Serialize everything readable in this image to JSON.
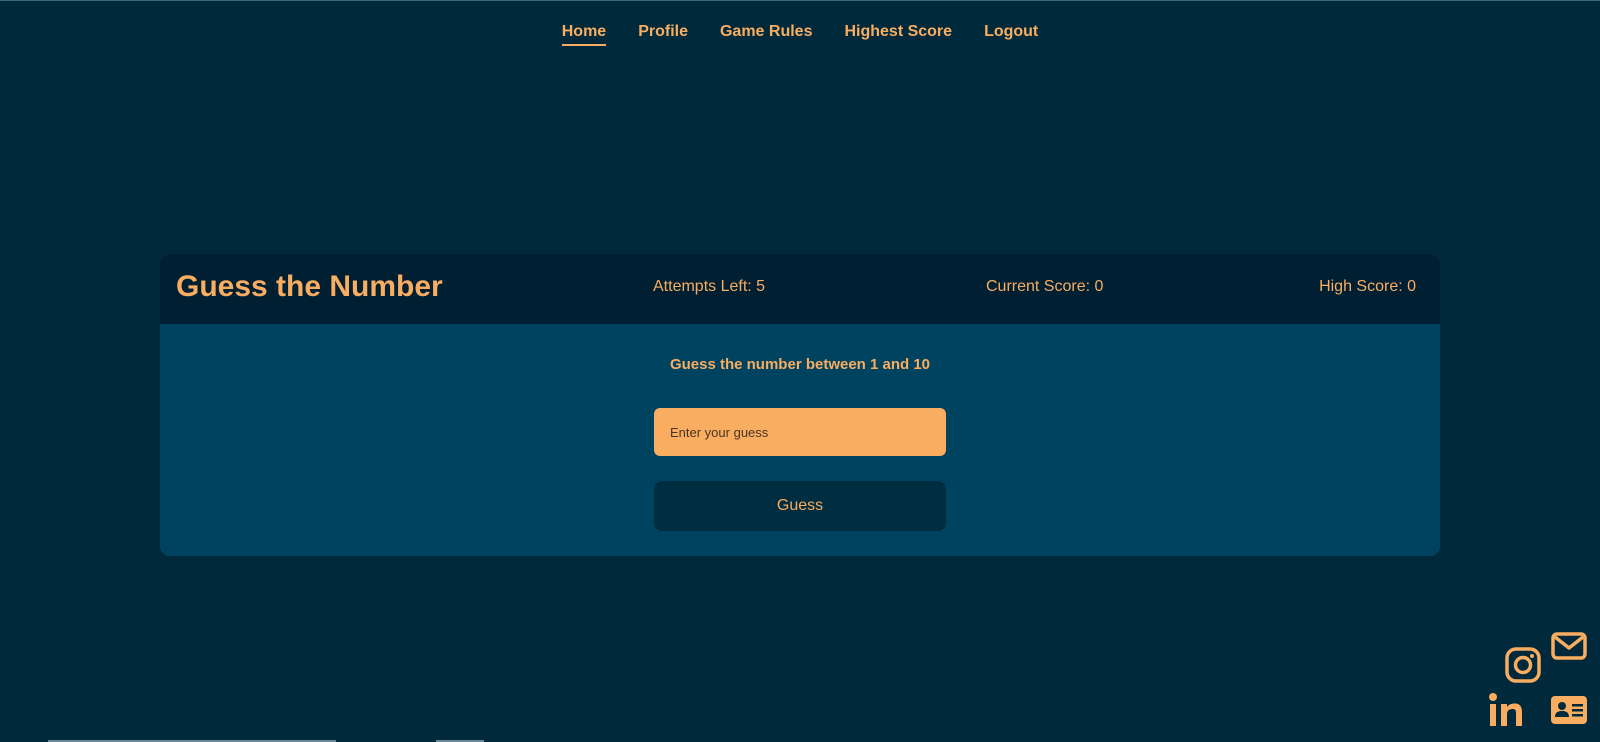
{
  "nav": {
    "items": [
      {
        "label": "Home",
        "active": true
      },
      {
        "label": "Profile",
        "active": false
      },
      {
        "label": "Game Rules",
        "active": false
      },
      {
        "label": "Highest Score",
        "active": false
      },
      {
        "label": "Logout",
        "active": false
      }
    ]
  },
  "game": {
    "title": "Guess the Number",
    "attempts_label": "Attempts Left: 5",
    "current_score_label": "Current Score: 0",
    "high_score_label": "High Score: 0",
    "prompt": "Guess the number between 1 and 10",
    "input_placeholder": "Enter your guess",
    "input_value": "",
    "button_label": "Guess"
  },
  "social": {
    "icons": [
      "email-icon",
      "instagram-icon",
      "linkedin-icon",
      "contact-card-icon"
    ]
  },
  "colors": {
    "background": "#002a3c",
    "header": "#001f33",
    "panel": "#004360",
    "accent": "#f8ad60",
    "button": "#002d40"
  }
}
